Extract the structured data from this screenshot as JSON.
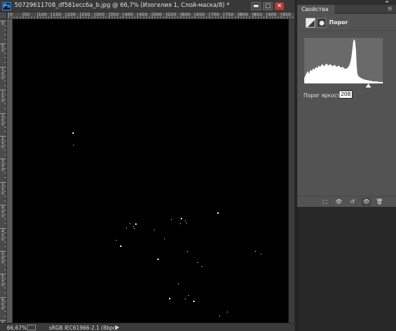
{
  "document": {
    "title": "50729611708_df581ecc6a_b.jpg @ 66,7% (Изогелия 1, Слой-маска/8) *",
    "app_logo": "Ps",
    "window_buttons": {
      "minimize": "▬",
      "maximize": "▢",
      "close": "✕"
    }
  },
  "rulers": {
    "horizontal_labels": [
      "0",
      "50",
      "100",
      "150",
      "200",
      "250",
      "300",
      "350",
      "400",
      "450",
      "500",
      "550",
      "600",
      "650",
      "700",
      "750",
      "800",
      "850",
      "900",
      "950"
    ],
    "vertical_labels": [
      "0",
      "50",
      "100",
      "150",
      "200",
      "250",
      "300",
      "350",
      "400",
      "450",
      "500",
      "550",
      "600",
      "650"
    ]
  },
  "status_bar": {
    "zoom": "66,67%",
    "profile": "sRGB IEC61966-2.1 (8bpc)",
    "arrow": "▶"
  },
  "properties_panel": {
    "tab_label": "Свойства",
    "menu_icon": "☰",
    "collapse_icon": "◂◂",
    "adjustment_name": "Порог",
    "threshold_label": "Порог яркости:",
    "threshold_value": "208",
    "threshold_fraction": 0.816,
    "bottom_buttons": {
      "clip": "⬚",
      "previous_state": "👁",
      "reset": "↺",
      "visibility": "👁",
      "delete": "🗑"
    }
  },
  "icons": {
    "adjustment": "threshold-adjustment-icon",
    "mask": "layer-mask-icon",
    "clip": "clip-to-layer-icon",
    "previous_state": "view-previous-state-icon",
    "reset": "reset-icon",
    "visibility": "eye-icon",
    "delete": "trash-icon"
  },
  "colors": {
    "canvas": "#000000",
    "panel": "#535353",
    "close_button": "#b73a33"
  }
}
